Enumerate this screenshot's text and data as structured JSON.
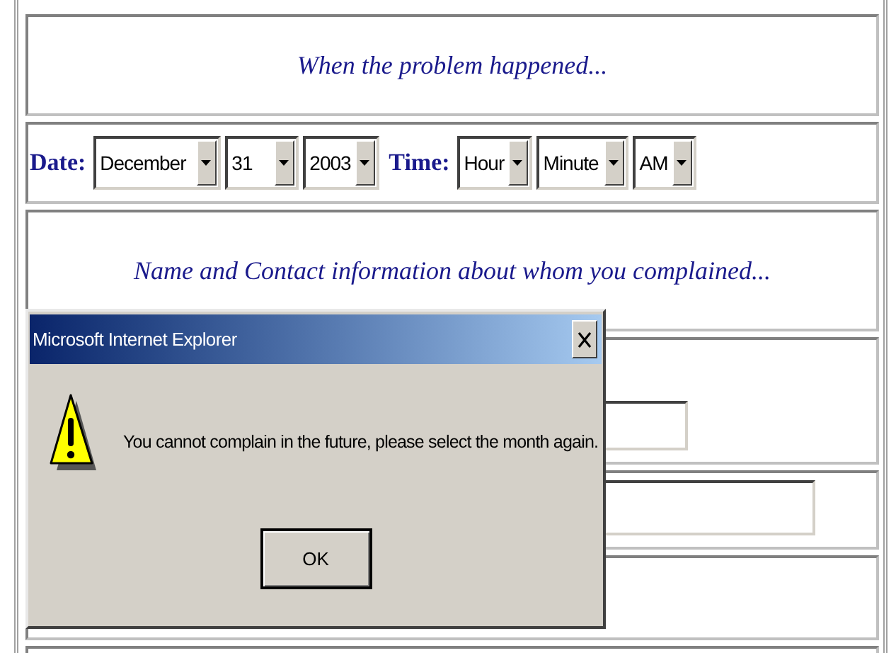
{
  "section_headings": [
    "When the problem happened...",
    "Name and Contact information about whom you complained..."
  ],
  "date_row": {
    "date_label": "Date:",
    "date_selects": [
      {
        "value": "December"
      },
      {
        "value": "31"
      },
      {
        "value": "2003"
      }
    ],
    "time_label": "Time:",
    "time_selects": [
      {
        "value": "Hour"
      },
      {
        "value": "Minute"
      },
      {
        "value": "AM"
      }
    ]
  },
  "dialog": {
    "title": "Microsoft Internet Explorer",
    "message": "You cannot complain in the future, please select the month again.",
    "button": "OK"
  }
}
